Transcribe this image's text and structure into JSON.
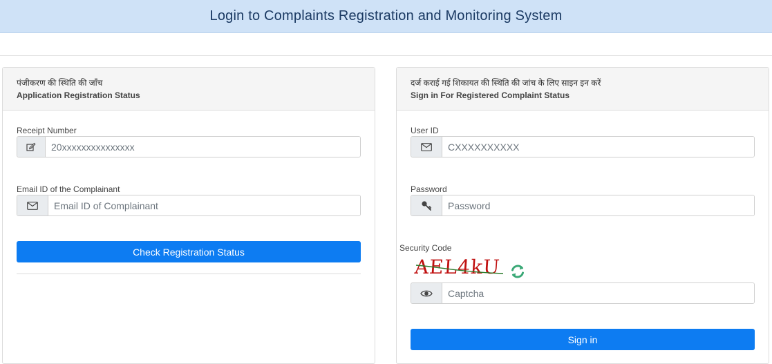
{
  "header": {
    "title": "Login to Complaints Registration and Monitoring System"
  },
  "left_panel": {
    "title_hindi": "पंजीकरण की स्थिति की जाँच",
    "title_english": "Application Registration Status",
    "receipt_label": "Receipt Number",
    "receipt_placeholder": "20xxxxxxxxxxxxxxx",
    "email_label": "Email ID of the Complainant",
    "email_placeholder": "Email ID of Complainant",
    "submit_label": "Check Registration Status"
  },
  "right_panel": {
    "title_hindi": "दर्ज कराई गई शिकायत की स्थिति की जांच के लिए साइन इन करें",
    "title_english": "Sign in For Registered Complaint Status",
    "userid_label": "User ID",
    "userid_placeholder": "CXXXXXXXXXX",
    "password_label": "Password",
    "password_placeholder": "Password",
    "security_label": "Security Code",
    "captcha_text": "AEL4kU",
    "captcha_placeholder": "Captcha",
    "signin_label": "Sign in"
  },
  "colors": {
    "header_bg": "#cfe2f7",
    "header_text": "#1b3a63",
    "primary_button": "#0d7cf2",
    "captcha_text": "#c01010",
    "refresh_icon": "#3aa876"
  },
  "icons": {
    "receipt": "edit-icon",
    "email": "envelope-icon",
    "userid": "envelope-icon",
    "password": "key-icon",
    "captcha_input": "eye-icon",
    "captcha_refresh": "refresh-icon"
  }
}
